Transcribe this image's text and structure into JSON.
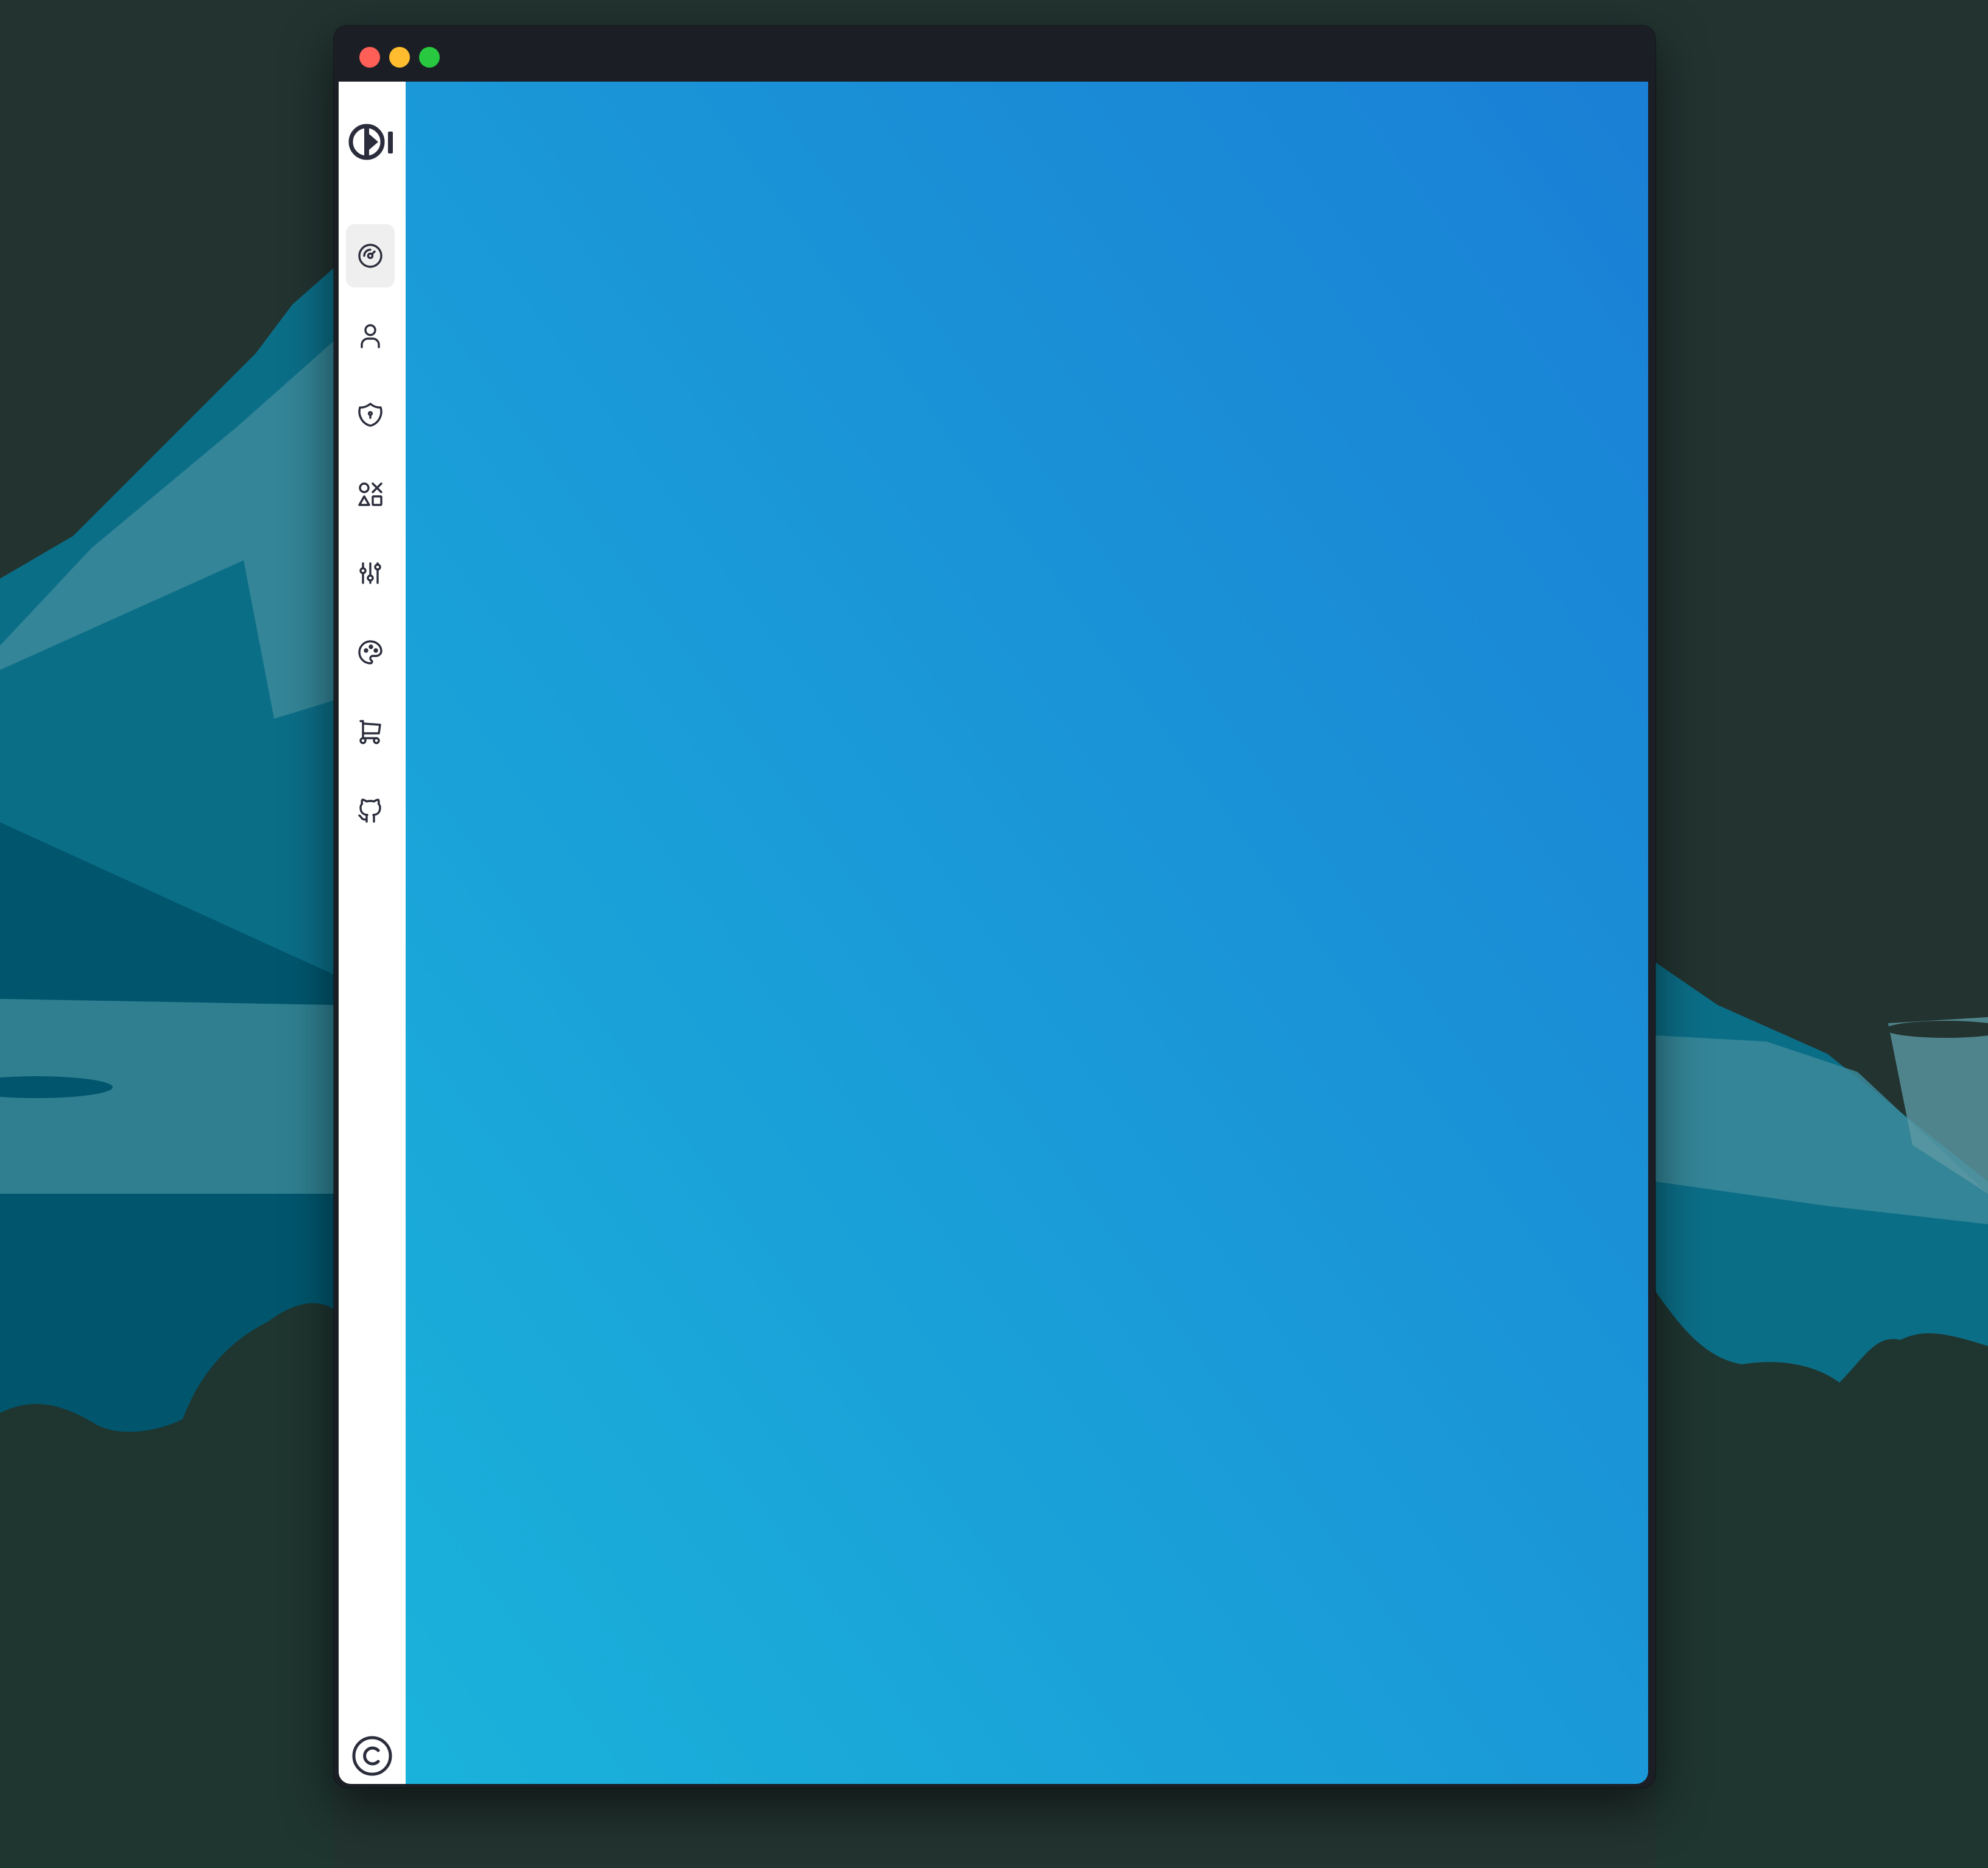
{
  "desktop": {
    "background": "#223330",
    "mountain_dark": "#01566d",
    "mountain_mid": "#0b6e87",
    "mountain_light": "#3b8a9a",
    "mountain_pale": "#5d98a4",
    "tree_line": "#1f3530"
  },
  "window": {
    "titlebar_color": "#1b1e25",
    "traffic_lights": [
      {
        "name": "close",
        "color": "#ff5f57"
      },
      {
        "name": "minimize",
        "color": "#febc2e"
      },
      {
        "name": "maximize",
        "color": "#28c840"
      }
    ]
  },
  "sidebar": {
    "logo_icon": "brand-logo-icon",
    "items": [
      {
        "icon": "dashboard-gauge-icon",
        "active": true
      },
      {
        "icon": "user-icon",
        "active": false
      },
      {
        "icon": "shield-lock-icon",
        "active": false
      },
      {
        "icon": "shapes-icon",
        "active": false
      },
      {
        "icon": "adjustments-sliders-icon",
        "active": false
      },
      {
        "icon": "palette-icon",
        "active": false
      },
      {
        "icon": "shopping-cart-icon",
        "active": false
      },
      {
        "icon": "github-icon",
        "active": false
      }
    ],
    "footer_icon": "copyright-icon",
    "active_bg": "#efefef",
    "icon_color": "#2b2d3c"
  },
  "content": {
    "gradient_top_right": "#1a7fd5",
    "gradient_bottom_left": "#1ab2da"
  }
}
